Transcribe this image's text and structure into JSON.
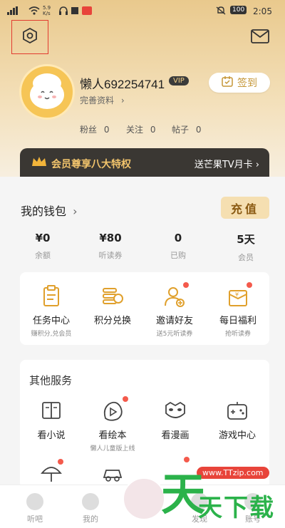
{
  "status_bar": {
    "speed": "5.9",
    "speed_unit": "K/s",
    "battery": "100",
    "time": "2:05"
  },
  "profile": {
    "username": "懒人692254741",
    "vip_badge": "VIP",
    "complete_profile": "完善资料",
    "sign_in": "签到",
    "stats": [
      {
        "label": "粉丝",
        "value": "0"
      },
      {
        "label": "关注",
        "value": "0"
      },
      {
        "label": "帖子",
        "value": "0"
      }
    ]
  },
  "vip_bar": {
    "text": "会员尊享八大特权",
    "promo": "送芒果TV月卡"
  },
  "wallet": {
    "title": "我的钱包",
    "recharge": "充值",
    "items": [
      {
        "value": "¥0",
        "label": "余额"
      },
      {
        "value": "¥80",
        "label": "听读券"
      },
      {
        "value": "0",
        "label": "已购"
      },
      {
        "value": "5天",
        "label": "会员"
      }
    ]
  },
  "tasks": [
    {
      "name": "任务中心",
      "sub": "赚积分,兑会员",
      "icon": "clipboard-icon"
    },
    {
      "name": "积分兑换",
      "sub": "",
      "icon": "coins-icon"
    },
    {
      "name": "邀请好友",
      "sub": "送5元听读券",
      "icon": "add-friend-icon"
    },
    {
      "name": "每日福利",
      "sub": "抢听读券",
      "icon": "gift-icon"
    }
  ],
  "services": {
    "title": "其他服务",
    "items": [
      {
        "name": "看小说",
        "sub": "",
        "icon": "book-icon"
      },
      {
        "name": "看绘本",
        "sub": "懒人儿童版上线",
        "icon": "play-icon"
      },
      {
        "name": "看漫画",
        "sub": "",
        "icon": "mask-icon"
      },
      {
        "name": "游戏中心",
        "sub": "",
        "icon": "gamepad-icon"
      }
    ]
  },
  "tabbar": [
    {
      "label": "听吧",
      "icon": "listen-icon"
    },
    {
      "label": "我的",
      "icon": "headphone-icon"
    },
    {
      "label": "",
      "icon": "center-avatar-icon"
    },
    {
      "label": "发现",
      "icon": "discover-icon"
    },
    {
      "label": "账号",
      "icon": "account-icon"
    }
  ],
  "watermark": {
    "url": "www.TTzip.com",
    "brand": "天下载"
  },
  "colors": {
    "gold": "#c59636",
    "dark": "#3a3733",
    "red_dot": "#f45a4c",
    "green": "#2bb24a"
  }
}
